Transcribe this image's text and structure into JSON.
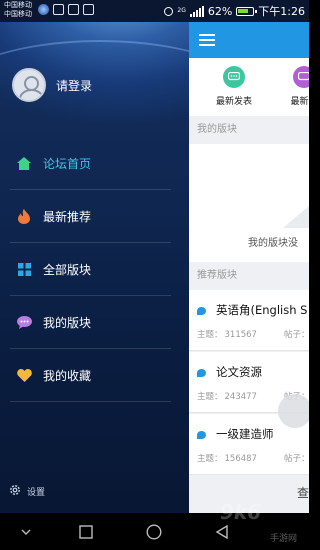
{
  "status_bar": {
    "carrier_1": "中国移动",
    "carrier_2": "中国移动",
    "network": "2G",
    "battery": "62%",
    "time": "下午1:26"
  },
  "drawer": {
    "login_label": "请登录",
    "menu": [
      {
        "label": "论坛首页",
        "icon": "home-icon",
        "active": true
      },
      {
        "label": "最新推荐",
        "icon": "flame-icon",
        "active": false
      },
      {
        "label": "全部版块",
        "icon": "grid-icon",
        "active": false
      },
      {
        "label": "我的版块",
        "icon": "chat-bubble-icon",
        "active": false
      },
      {
        "label": "我的收藏",
        "icon": "heart-icon",
        "active": false
      }
    ],
    "settings_label": "设置"
  },
  "main": {
    "quick_actions": [
      {
        "label": "最新发表",
        "color": "#3cc7a0"
      },
      {
        "label": "最新回",
        "color": "#b25fd3"
      }
    ],
    "my_boards_header": "我的版块",
    "my_boards_empty": "我的版块没",
    "recommended_header": "推荐版块",
    "forums": [
      {
        "title": "英语角(English S",
        "topics_label": "主题：",
        "topics": "311567",
        "posts_label": "帖子："
      },
      {
        "title": "论文资源",
        "topics_label": "主题：",
        "topics": "243477",
        "posts_label": "帖子："
      },
      {
        "title": "一级建造师",
        "topics_label": "主题：",
        "topics": "156487",
        "posts_label": "帖子："
      }
    ],
    "bottom_text": "查"
  },
  "watermark": {
    "main": "9k6",
    "sub": "手游网"
  },
  "colors": {
    "accent": "#2196e3",
    "active_menu": "#3ec7e8",
    "drawer_bg": "#0f2650"
  }
}
